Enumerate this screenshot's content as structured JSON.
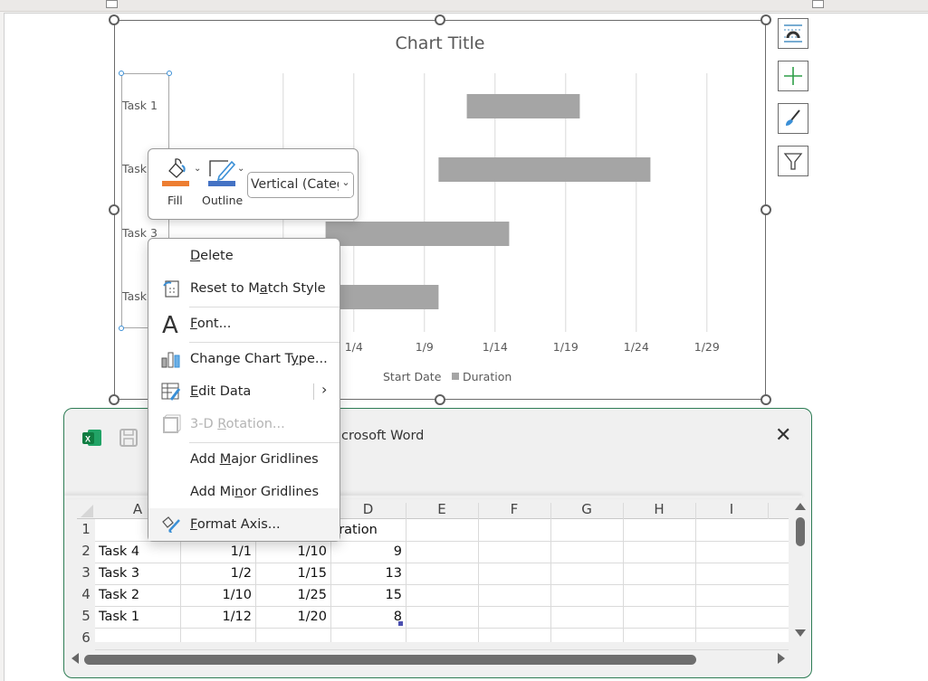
{
  "chart": {
    "title": "Chart Title",
    "legend": [
      "Start Date",
      "Duration"
    ],
    "x_ticks": [
      "1/4",
      "1/9",
      "1/14",
      "1/19",
      "1/24",
      "1/29"
    ],
    "categories_visible": [
      "Task 1",
      "Task",
      "Task 3",
      "Task"
    ],
    "side_buttons": [
      "layout-options",
      "chart-elements",
      "chart-styles",
      "chart-filters"
    ]
  },
  "chart_data": {
    "type": "bar",
    "title": "Chart Title",
    "orientation": "horizontal-stacked",
    "categories": [
      "Task 1",
      "Task 2",
      "Task 3",
      "Task 4"
    ],
    "series": [
      {
        "name": "Start Date",
        "values": [
          "1/12",
          "1/10",
          "1/2",
          "1/1"
        ],
        "start_day": [
          12,
          10,
          2,
          1
        ],
        "hidden": true
      },
      {
        "name": "Duration",
        "values": [
          8,
          15,
          13,
          9
        ],
        "color": "#a5a5a5"
      }
    ],
    "x_ticks": [
      "1/4",
      "1/9",
      "1/14",
      "1/19",
      "1/24",
      "1/29"
    ],
    "xlim_days": [
      -9,
      31
    ],
    "grid": true,
    "legend": "bottom"
  },
  "mini_toolbar": {
    "fill_label": "Fill",
    "outline_label": "Outline",
    "fill_color": "#ed7d31",
    "outline_color": "#4472c4",
    "element_select": "Vertical (Categ"
  },
  "context_menu": {
    "items": [
      {
        "label": "Delete",
        "accel": "D",
        "icon": "none",
        "enabled": true
      },
      {
        "label": "Reset to Match Style",
        "accel": "a",
        "icon": "reset-style-icon",
        "enabled": true
      },
      {
        "label": "Font...",
        "accel": "F",
        "icon": "font-icon",
        "enabled": true
      },
      {
        "label": "Change Chart Type...",
        "accel": "y",
        "icon": "chart-type-icon",
        "enabled": true
      },
      {
        "label": "Edit Data",
        "accel": "E",
        "icon": "edit-data-icon",
        "enabled": true,
        "submenu": true
      },
      {
        "label": "3-D Rotation...",
        "accel": "R",
        "icon": "3d-rotation-icon",
        "enabled": false
      },
      {
        "label": "Add Major Gridlines",
        "accel": "M",
        "icon": "none",
        "enabled": true
      },
      {
        "label": "Add Minor Gridlines",
        "accel": "n",
        "icon": "none",
        "enabled": true
      },
      {
        "label": "Format Axis...",
        "accel": "F",
        "icon": "format-axis-icon",
        "enabled": true
      }
    ]
  },
  "excel_window": {
    "title_visible": "icrosoft Word",
    "columns": [
      "A",
      "B",
      "C",
      "D",
      "E",
      "F",
      "G",
      "H",
      "I"
    ],
    "rows": [
      "1",
      "2",
      "3",
      "4",
      "5",
      "6"
    ],
    "cells": [
      [
        "",
        "",
        "",
        "Duration"
      ],
      [
        "Task 4",
        "1/1",
        "1/10",
        "9"
      ],
      [
        "Task 3",
        "1/2",
        "1/15",
        "13"
      ],
      [
        "Task 2",
        "1/10",
        "1/25",
        "15"
      ],
      [
        "Task 1",
        "1/12",
        "1/20",
        "8"
      ],
      [
        "",
        "",
        "",
        ""
      ]
    ],
    "d1_visible": "uration"
  }
}
